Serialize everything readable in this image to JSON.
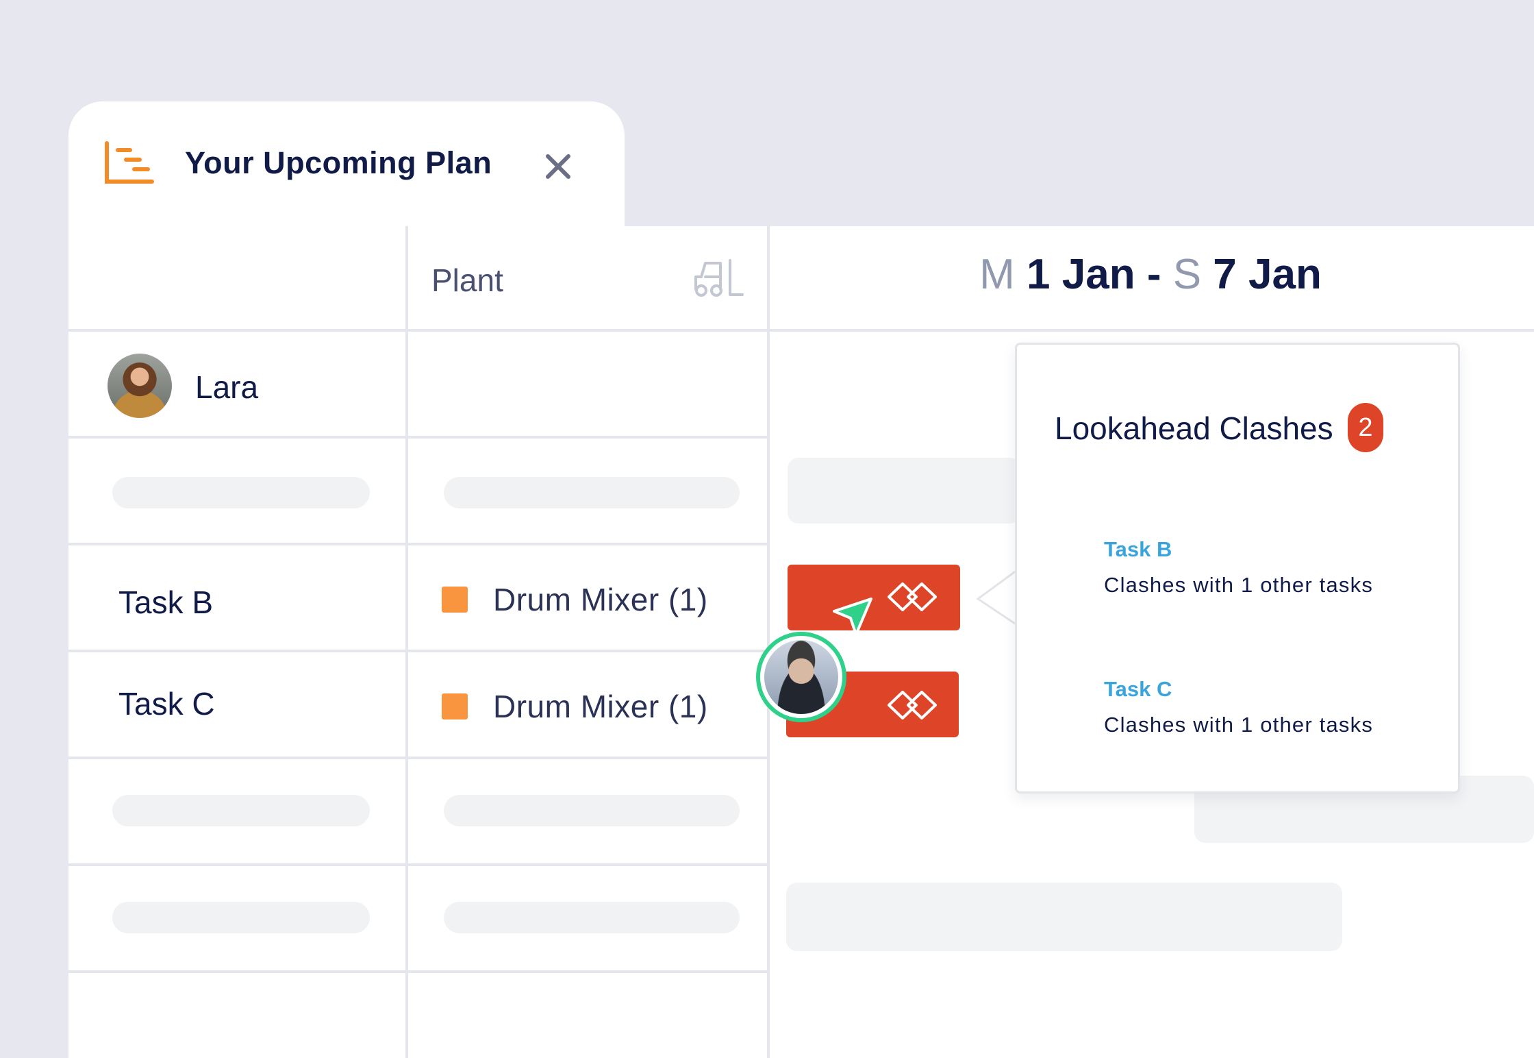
{
  "tab": {
    "title": "Your Upcoming Plan",
    "icon": "gantt-chart-icon",
    "accent": "#f28c28"
  },
  "header": {
    "plant_label": "Plant",
    "plant_icon": "forklift-icon",
    "date_start_day": "M",
    "date_start": "1 Jan",
    "date_separator": "-",
    "date_end_day": "S",
    "date_end": "7 Jan"
  },
  "rows": {
    "person": "Lara",
    "task_b": {
      "name": "Task B",
      "plant": "Drum Mixer (1)"
    },
    "task_c": {
      "name": "Task C",
      "plant": "Drum Mixer (1)"
    }
  },
  "popup": {
    "title": "Lookahead Clashes",
    "count": "2",
    "items": [
      {
        "task": "Task B",
        "desc": "Clashes with 1 other tasks"
      },
      {
        "task": "Task C",
        "desc": "Clashes with 1 other tasks"
      }
    ]
  },
  "colors": {
    "clash": "#dd4428",
    "plant_swatch": "#f9943f",
    "link": "#3aa4dd",
    "cursor": "#2fd18a"
  }
}
